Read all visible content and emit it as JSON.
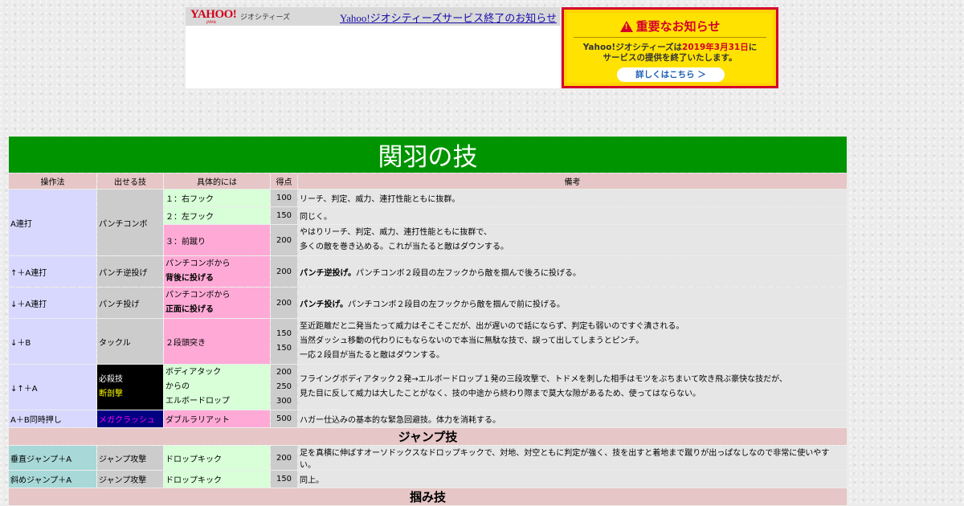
{
  "banner": {
    "logo": "YAHOO!",
    "logo_sub": "JAPAN",
    "service": "ジオシティーズ",
    "link_text": "Yahoo!ジオシティーズサービス終了のお知らせ"
  },
  "notice": {
    "title": "重要なお知らせ",
    "body_pre": "Yahoo!ジオシティーズは",
    "body_date": "2019年3月31日",
    "body_post": "に",
    "body_line2": "サービスの提供を終了いたします。",
    "button": "詳しくはこちら ＞"
  },
  "page": {
    "title": "関羽の技"
  },
  "headers": [
    "操作法",
    "出せる技",
    "具体的には",
    "得点",
    "備考"
  ],
  "rows": {
    "a_op": "A連打",
    "a_move": "パンチコンボ",
    "a1_detail": "１：右フック",
    "a1_pt": "100",
    "a1_note": "リーチ、判定、威力、連打性能ともに抜群。",
    "a2_detail": "２：左フック",
    "a2_pt": "150",
    "a2_note": "同じく。",
    "a3_detail": "３：前蹴り",
    "a3_pt": "200",
    "a3_note1": "やはりリーチ、判定、威力、連打性能ともに抜群で、",
    "a3_note2": "多くの敵を巻き込める。これが当たると敵はダウンする。",
    "ua_op": "↑＋A連打",
    "ua_move": "パンチ逆投げ",
    "ua_detail1": "パンチコンボから",
    "ua_detail2": "背後に投げる",
    "ua_pt": "200",
    "ua_note_bold": "パンチ逆投げ。",
    "ua_note": "パンチコンボ２段目の左フックから敵を掴んで後ろに投げる。",
    "da_op": "↓＋A連打",
    "da_move": "パンチ投げ",
    "da_detail1": "パンチコンボから",
    "da_detail2": "正面に投げる",
    "da_pt": "200",
    "da_note_bold": "パンチ投げ。",
    "da_note": "パンチコンボ２段目の左フックから敵を掴んで前に投げる。",
    "db_op": "↓＋B",
    "db_move": "タックル",
    "db_detail": "２段頭突き",
    "db_pt1": "150",
    "db_pt2": "150",
    "db_note1": "至近距離だと二発当たって威力はそこそこだが、出が遅いので話にならず、判定も弱いのですぐ潰される。",
    "db_note2": "当然ダッシュ移動の代わりにもならないので本当に無駄な技で、誤って出してしまうとピンチ。",
    "db_note3": "一応２段目が当たると敵はダウンする。",
    "dua_op": "↓↑＋A",
    "dua_move1": "必殺技",
    "dua_move2": "断剖撃",
    "dua_detail1": "ボディアタック",
    "dua_detail2": "からの",
    "dua_detail3": "エルボードロップ",
    "dua_pt1": "200",
    "dua_pt2": "250",
    "dua_pt3": "300",
    "dua_note1": "フライングボディアタック２発→エルボードロップ１発の三段攻撃で、トドメを刺した相手はモツをぶちまいて吹き飛ぶ豪快な技だが、",
    "dua_note2": "見た目に反して威力は大したことがなく、技の中途から終わり際まで莫大な隙があるため、使ってはならない。",
    "ab_op": "A＋B同時押し",
    "ab_move": "メガクラッシュ",
    "ab_detail": "ダブルラリアット",
    "ab_pt": "500",
    "ab_note": "ハガー仕込みの基本的な緊急回避技。体力を消耗する。"
  },
  "jump": {
    "section": "ジャンプ技",
    "v_op": "垂直ジャンプ＋A",
    "v_move": "ジャンプ攻撃",
    "v_detail": "ドロップキック",
    "v_pt": "200",
    "v_note": "足を真横に伸ばすオーソドックスなドロップキックで、対地、対空ともに判定が強く、技を出すと着地まで蹴りが出っぱなしなので非常に使いやすい。",
    "s_op": "斜めジャンプ＋A",
    "s_move": "ジャンプ攻撃",
    "s_detail": "ドロップキック",
    "s_pt": "150",
    "s_note": "同上。"
  },
  "grab": {
    "section": "掴み技"
  }
}
